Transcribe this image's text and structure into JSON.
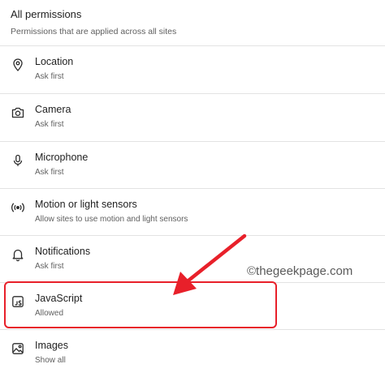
{
  "header": {
    "title": "All permissions",
    "subtitle": "Permissions that are applied across all sites"
  },
  "permissions": [
    {
      "label": "Location",
      "status": "Ask first",
      "icon": "location-pin-icon"
    },
    {
      "label": "Camera",
      "status": "Ask first",
      "icon": "camera-icon"
    },
    {
      "label": "Microphone",
      "status": "Ask first",
      "icon": "microphone-icon"
    },
    {
      "label": "Motion or light sensors",
      "status": "Allow sites to use motion and light sensors",
      "icon": "sensor-icon"
    },
    {
      "label": "Notifications",
      "status": "Ask first",
      "icon": "bell-icon"
    },
    {
      "label": "JavaScript",
      "status": "Allowed",
      "icon": "javascript-icon"
    },
    {
      "label": "Images",
      "status": "Show all",
      "icon": "image-icon"
    }
  ],
  "annotation": {
    "watermark": "©thegeekpage.com",
    "highlight_color": "#e8202a"
  }
}
